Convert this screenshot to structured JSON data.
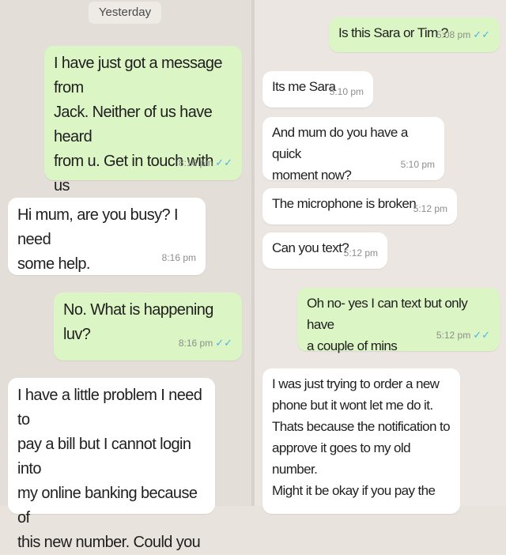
{
  "date_separator": "Yesterday",
  "left_messages": [
    {
      "text": "I have just got a message from\nJack. Neither of us have heard\nfrom u. Get in touch with us\nwhen u can",
      "emoji": "smiling-face-with-hearts-icon",
      "time": "8:16 pm",
      "status": "✓✓"
    },
    {
      "text": "Hi mum, are you busy? I need\nsome help.",
      "time": "8:16 pm"
    },
    {
      "text": "No. What is happening luv?",
      "time": "8:16 pm",
      "status": "✓✓"
    },
    {
      "text": "I have a little problem I need to\npay a bill but I cannot login into\nmy online banking because of\nthis new number. Could you",
      "time": ""
    }
  ],
  "right_messages": [
    {
      "text": "Is this Sara or Tim ?",
      "time": "5:08 pm",
      "status": "✓✓"
    },
    {
      "text": "Its me Sara",
      "time": "5:10 pm"
    },
    {
      "text": "And mum do you have a quick\nmoment now?",
      "time": "5:10 pm"
    },
    {
      "text": "The microphone is broken",
      "time": "5:12 pm"
    },
    {
      "text": "Can you text?",
      "time": "5:12 pm"
    },
    {
      "text": "Oh no- yes I can text but only have\na couple of mins",
      "time": "5:12 pm",
      "status": "✓✓"
    },
    {
      "text": "I was just trying to order a new\nphone but it wont let me do it.\nThats because the notification to\napprove it goes to my old number.\nMight it be okay if you pay the",
      "time": ""
    }
  ],
  "colors": {
    "outgoing_bubble": "#dcf5c4",
    "incoming_bubble": "#ffffff",
    "read_ticks": "#4fb1eb",
    "background": "#e3ded8"
  }
}
